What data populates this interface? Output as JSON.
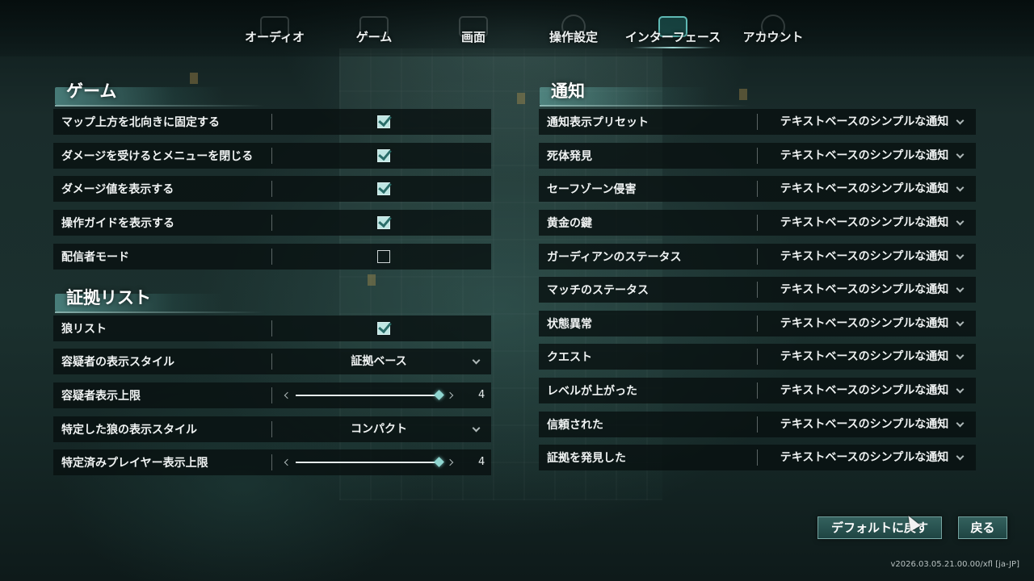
{
  "nav": {
    "tabs": [
      {
        "label": "オーディオ",
        "icon": "speaker-icon",
        "active": false
      },
      {
        "label": "ゲーム",
        "icon": "gamepad-icon",
        "active": false
      },
      {
        "label": "画面",
        "icon": "display-icon",
        "active": false
      },
      {
        "label": "操作設定",
        "icon": "joystick-icon",
        "active": false
      },
      {
        "label": "インターフェース",
        "icon": "interface-icon",
        "active": true
      },
      {
        "label": "アカウント",
        "icon": "account-icon",
        "active": false
      }
    ]
  },
  "game_section": {
    "title": "ゲーム",
    "rows": [
      {
        "label": "マップ上方を北向きに固定する",
        "type": "checkbox",
        "checked": true
      },
      {
        "label": "ダメージを受けるとメニューを閉じる",
        "type": "checkbox",
        "checked": true
      },
      {
        "label": "ダメージ値を表示する",
        "type": "checkbox",
        "checked": true
      },
      {
        "label": "操作ガイドを表示する",
        "type": "checkbox",
        "checked": true
      },
      {
        "label": "配信者モード",
        "type": "checkbox",
        "checked": false
      }
    ]
  },
  "evidence_section": {
    "title": "証拠リスト",
    "rows": [
      {
        "label": "狼リスト",
        "type": "checkbox",
        "checked": true
      },
      {
        "label": "容疑者の表示スタイル",
        "type": "dropdown",
        "value": "証拠ベース"
      },
      {
        "label": "容疑者表示上限",
        "type": "slider",
        "value": "4"
      },
      {
        "label": "特定した狼の表示スタイル",
        "type": "dropdown",
        "value": "コンパクト"
      },
      {
        "label": "特定済みプレイヤー表示上限",
        "type": "slider",
        "value": "4"
      }
    ]
  },
  "notify_section": {
    "title": "通知",
    "rows": [
      {
        "label": "通知表示プリセット",
        "value": "テキストベースのシンプルな通知"
      },
      {
        "label": "死体発見",
        "value": "テキストベースのシンプルな通知"
      },
      {
        "label": "セーフゾーン侵害",
        "value": "テキストベースのシンプルな通知"
      },
      {
        "label": "黄金の鍵",
        "value": "テキストベースのシンプルな通知"
      },
      {
        "label": "ガーディアンのステータス",
        "value": "テキストベースのシンプルな通知"
      },
      {
        "label": "マッチのステータス",
        "value": "テキストベースのシンプルな通知"
      },
      {
        "label": "状態異常",
        "value": "テキストベースのシンプルな通知"
      },
      {
        "label": "クエスト",
        "value": "テキストベースのシンプルな通知"
      },
      {
        "label": "レベルが上がった",
        "value": "テキストベースのシンプルな通知"
      },
      {
        "label": "信頼された",
        "value": "テキストベースのシンプルな通知"
      },
      {
        "label": "証拠を発見した",
        "value": "テキストベースのシンプルな通知"
      }
    ]
  },
  "buttons": {
    "reset_label": "デフォルトに戻す",
    "back_label": "戻る"
  },
  "version": "v2026.03.05.21.00.00/xfl [ja-JP]",
  "colors": {
    "accent": "#5fb9b4",
    "row_bg": "#081010",
    "checkbox_fill": "#bfe6e3"
  }
}
